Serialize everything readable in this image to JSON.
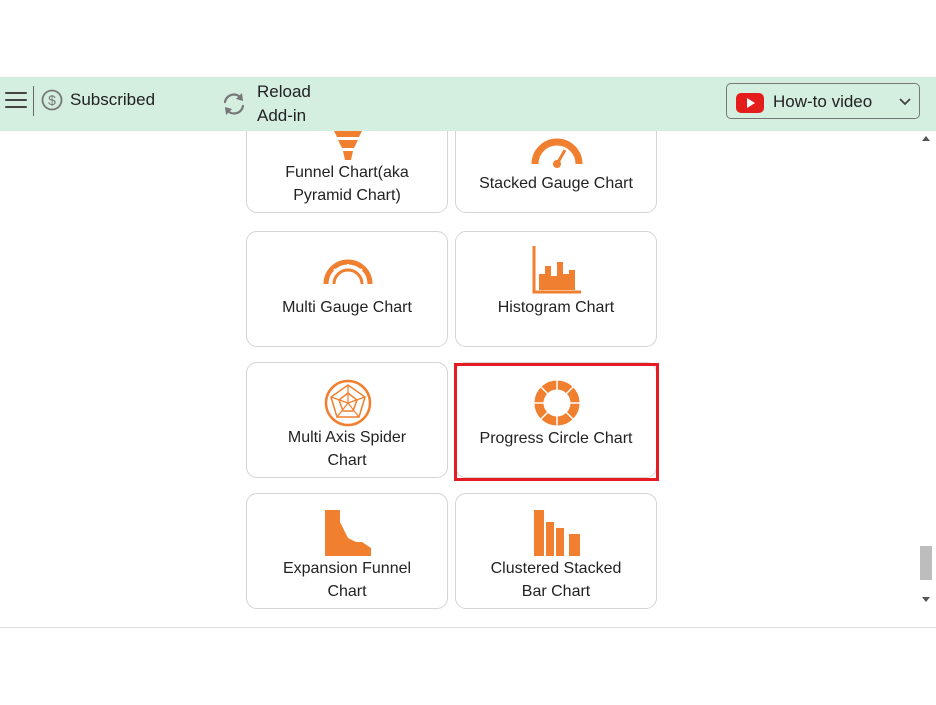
{
  "toolbar": {
    "subscription_status": "Subscribed",
    "reload_line1": "Reload",
    "reload_line2": "Add-in",
    "howto_label": "How-to video",
    "bg_color": "#d4eee0"
  },
  "colors": {
    "icon_orange": "#f07f2f",
    "highlight_red": "#e51c23",
    "youtube_red": "#e51c1c"
  },
  "cards": [
    {
      "line1": "Funnel Chart(aka",
      "line2": "Pyramid Chart)",
      "icon": "funnel-chart-icon"
    },
    {
      "line1": "Stacked Gauge Chart",
      "line2": "",
      "icon": "stacked-gauge-icon"
    },
    {
      "line1": "Multi Gauge Chart",
      "line2": "",
      "icon": "multi-gauge-icon"
    },
    {
      "line1": "Histogram Chart",
      "line2": "",
      "icon": "histogram-icon"
    },
    {
      "line1": "Multi Axis Spider",
      "line2": "Chart",
      "icon": "spider-chart-icon"
    },
    {
      "line1": "Progress Circle Chart",
      "line2": "",
      "icon": "progress-circle-icon",
      "selected": true
    },
    {
      "line1": "Expansion Funnel",
      "line2": "Chart",
      "icon": "expansion-funnel-icon"
    },
    {
      "line1": "Clustered Stacked",
      "line2": "Bar Chart",
      "icon": "clustered-stacked-bar-icon"
    }
  ]
}
